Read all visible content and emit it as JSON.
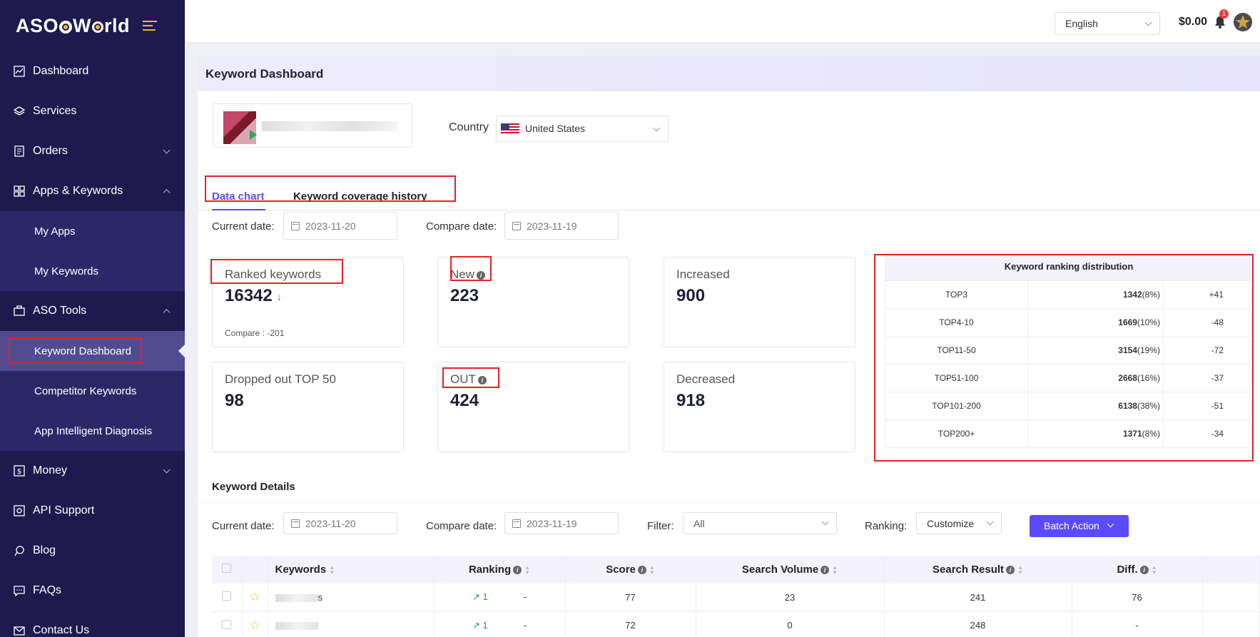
{
  "brand": {
    "name_part1": "ASO",
    "name_part2": "W",
    "name_part3": "rld"
  },
  "sidebar": {
    "items": [
      {
        "label": "Dashboard",
        "icon": "chart-line-icon"
      },
      {
        "label": "Services",
        "icon": "layers-icon"
      },
      {
        "label": "Orders",
        "icon": "list-icon"
      },
      {
        "label": "Apps & Keywords",
        "icon": "grid-icon"
      },
      {
        "label": "My Apps"
      },
      {
        "label": "My Keywords"
      },
      {
        "label": "ASO Tools",
        "icon": "briefcase-icon"
      },
      {
        "label": "Keyword Dashboard"
      },
      {
        "label": "Competitor Keywords"
      },
      {
        "label": "App Intelligent Diagnosis"
      },
      {
        "label": "Money",
        "icon": "dollar-icon"
      },
      {
        "label": "API Support",
        "icon": "api-icon"
      },
      {
        "label": "Blog",
        "icon": "blog-icon"
      },
      {
        "label": "FAQs",
        "icon": "chat-icon"
      },
      {
        "label": "Contact Us",
        "icon": "mail-icon"
      }
    ]
  },
  "topbar": {
    "language": "English",
    "balance": "$0.00",
    "notification_count": "1"
  },
  "page": {
    "title": "Keyword Dashboard",
    "country_label": "Country",
    "country_value": "United States"
  },
  "tabs": {
    "data_chart": "Data chart",
    "coverage_history": "Keyword coverage history"
  },
  "dates": {
    "current_label": "Current date:",
    "current_value": "2023-11-20",
    "compare_label": "Compare date:",
    "compare_value": "2023-11-19"
  },
  "stats": {
    "ranked_label": "Ranked keywords",
    "ranked_value": "16342",
    "ranked_compare": "Compare : -201",
    "new_label": "New",
    "new_value": "223",
    "increased_label": "Increased",
    "increased_value": "900",
    "dropped_label": "Dropped out TOP 50",
    "dropped_value": "98",
    "out_label": "OUT",
    "out_value": "424",
    "decreased_label": "Decreased",
    "decreased_value": "918"
  },
  "distribution": {
    "title": "Keyword ranking distribution",
    "rows": [
      {
        "range": "TOP3",
        "count": "1342",
        "pct": "(8%)",
        "change": "+41"
      },
      {
        "range": "TOP4-10",
        "count": "1669",
        "pct": "(10%)",
        "change": "-48"
      },
      {
        "range": "TOP11-50",
        "count": "3154",
        "pct": "(19%)",
        "change": "-72"
      },
      {
        "range": "TOP51-100",
        "count": "2668",
        "pct": "(16%)",
        "change": "-37"
      },
      {
        "range": "TOP101-200",
        "count": "6138",
        "pct": "(38%)",
        "change": "-51"
      },
      {
        "range": "TOP200+",
        "count": "1371",
        "pct": "(8%)",
        "change": "-34"
      }
    ]
  },
  "details": {
    "title": "Keyword Details",
    "filter_label": "Filter:",
    "filter_value": "All",
    "ranking_label": "Ranking:",
    "ranking_value": "Customize",
    "batch_action": "Batch Action",
    "columns": [
      "Keywords",
      "Ranking",
      "Score",
      "Search Volume",
      "Search Result",
      "Diff."
    ],
    "rows": [
      {
        "keyword_suffix": "s",
        "rank": "1",
        "rank_change": "-",
        "score": "77",
        "volume": "23",
        "result": "241",
        "diff": "76"
      },
      {
        "keyword_suffix": "",
        "rank": "1",
        "rank_change": "-",
        "score": "72",
        "volume": "0",
        "result": "248",
        "diff": "-"
      }
    ]
  },
  "colors": {
    "sidebar_bg": "#1e1a4e",
    "accent": "#5b4bff",
    "highlight_red": "#e02424",
    "positive": "#e33",
    "negative": "#2a9d4a"
  }
}
